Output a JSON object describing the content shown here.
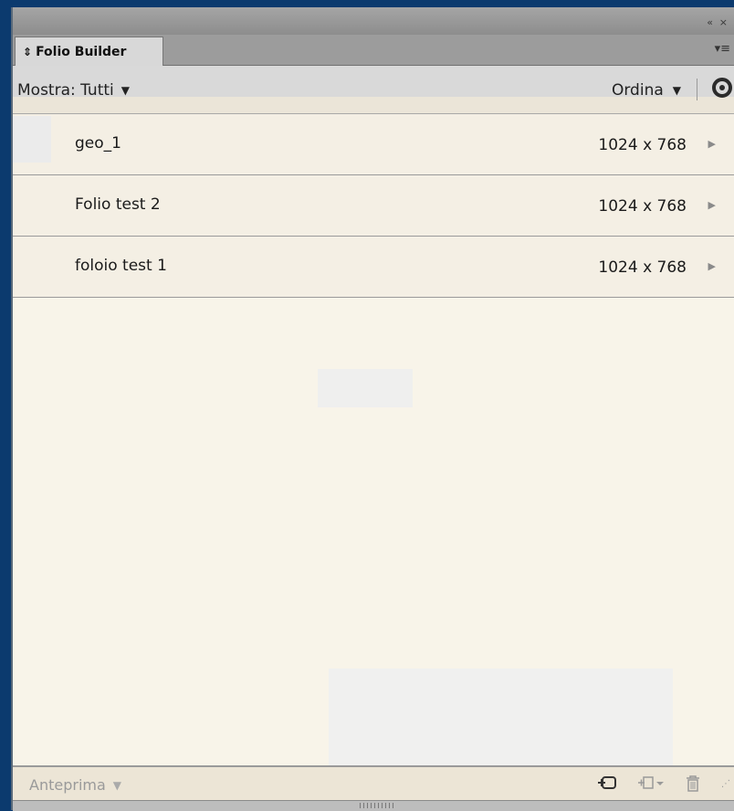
{
  "window": {
    "controls": "«  ×"
  },
  "panel": {
    "tab_label": "Folio Builder",
    "menu_icon": "panel-menu-icon"
  },
  "toolbar": {
    "show_label": "Mostra: Tutti",
    "sort_label": "Ordina",
    "target_icon": "target-icon"
  },
  "folios": [
    {
      "name": "geo_1",
      "size": "1024 x 768"
    },
    {
      "name": "Folio test 2",
      "size": "1024 x 768"
    },
    {
      "name": "foloio test 1",
      "size": "1024 x 768"
    }
  ],
  "bottom": {
    "preview_label": "Anteprima",
    "icons": [
      "new-folio-icon",
      "add-article-icon",
      "trash-icon"
    ]
  },
  "colors": {
    "desktop": "#0b3a6e",
    "panel_bg": "#f8f4e9",
    "row_bg": "#f4efe4"
  }
}
